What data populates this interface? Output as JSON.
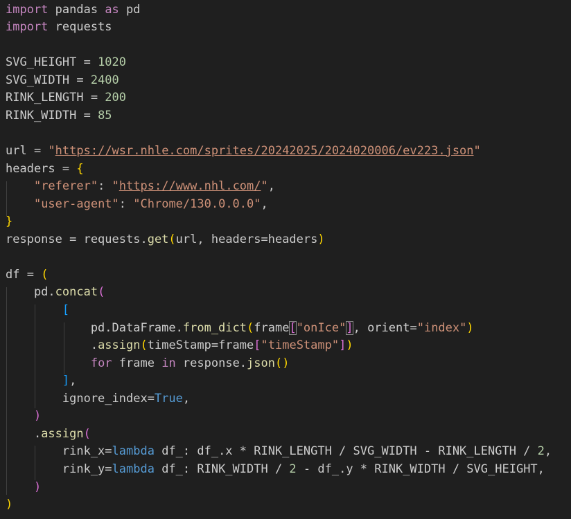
{
  "editor": {
    "language": "python",
    "theme_colors": {
      "background": "#1f1f1f",
      "keyword": "#c586c0",
      "string": "#ce9178",
      "number": "#b5cea8",
      "function": "#dcdcaa",
      "bracket_level_1": "#ffd700",
      "bracket_level_2": "#da70d6",
      "bracket_level_3": "#179fff"
    },
    "lines": [
      "import pandas as pd",
      "import requests",
      "",
      "SVG_HEIGHT = 1020",
      "SVG_WIDTH = 2400",
      "RINK_LENGTH = 200",
      "RINK_WIDTH = 85",
      "",
      "url = \"https://wsr.nhle.com/sprites/20242025/2024020006/ev223.json\"",
      "headers = {",
      "    \"referer\": \"https://www.nhl.com/\",",
      "    \"user-agent\": \"Chrome/130.0.0.0\",",
      "}",
      "response = requests.get(url, headers=headers)",
      "",
      "df = (",
      "    pd.concat(",
      "        [",
      "            pd.DataFrame.from_dict(frame[\"onIce\"], orient=\"index\")",
      "            .assign(timeStamp=frame[\"timeStamp\"])",
      "            for frame in response.json()",
      "        ],",
      "        ignore_index=True,",
      "    )",
      "    .assign(",
      "        rink_x=lambda df_: df_.x * RINK_LENGTH / SVG_WIDTH - RINK_LENGTH / 2,",
      "        rink_y=lambda df_: RINK_WIDTH / 2 - df_.y * RINK_WIDTH / SVG_HEIGHT,",
      "    )",
      ")"
    ]
  }
}
